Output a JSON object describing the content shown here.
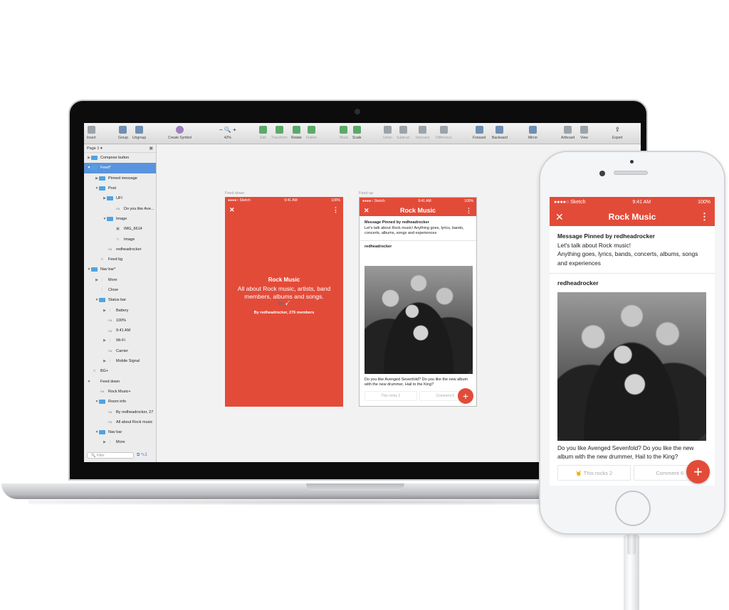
{
  "toolbar": {
    "items": [
      {
        "label": "Insert",
        "icon": "insert-icon"
      },
      {
        "label": "Group",
        "icon": "group-icon"
      },
      {
        "label": "Ungroup",
        "icon": "ungroup-icon"
      },
      {
        "label": "Create Symbol",
        "icon": "symbol-icon"
      },
      {
        "label": "42%",
        "icon": "zoom-icon"
      },
      {
        "label": "Edit",
        "icon": "edit-icon"
      },
      {
        "label": "Transform",
        "icon": "transform-icon"
      },
      {
        "label": "Rotate",
        "icon": "rotate-icon"
      },
      {
        "label": "Flatten",
        "icon": "flatten-icon"
      },
      {
        "label": "Mask",
        "icon": "mask-icon"
      },
      {
        "label": "Scale",
        "icon": "scale-icon"
      },
      {
        "label": "Union",
        "icon": "union-icon"
      },
      {
        "label": "Subtract",
        "icon": "subtract-icon"
      },
      {
        "label": "Intersect",
        "icon": "intersect-icon"
      },
      {
        "label": "Difference",
        "icon": "difference-icon"
      },
      {
        "label": "Forward",
        "icon": "forward-icon"
      },
      {
        "label": "Backward",
        "icon": "backward-icon"
      },
      {
        "label": "Mirror",
        "icon": "mirror-icon"
      },
      {
        "label": "Artboard",
        "icon": "artboard-icon"
      },
      {
        "label": "View",
        "icon": "view-icon"
      },
      {
        "label": "Export",
        "icon": "export-icon"
      }
    ]
  },
  "sidebar": {
    "page": "Page 1",
    "layers": [
      {
        "label": "Compose button",
        "type": "folder"
      },
      {
        "label": "Feed*",
        "type": "folder",
        "selected": true
      },
      {
        "label": "Pinned message",
        "type": "folder"
      },
      {
        "label": "Post",
        "type": "folder"
      },
      {
        "label": "UFI",
        "type": "folder"
      },
      {
        "label": "Do you like Ave...",
        "type": "text"
      },
      {
        "label": "Image",
        "type": "folder"
      },
      {
        "label": "IMG_6614",
        "type": "image"
      },
      {
        "label": "Image",
        "type": "shape"
      },
      {
        "label": "redheadrocker",
        "type": "text"
      },
      {
        "label": "Feed bg",
        "type": "shape"
      },
      {
        "label": "Nav bar*",
        "type": "folder"
      },
      {
        "label": "More",
        "type": "symbol"
      },
      {
        "label": "Close",
        "type": "symbol"
      },
      {
        "label": "Status bar",
        "type": "folder"
      },
      {
        "label": "Battery",
        "type": "symbol"
      },
      {
        "label": "100%",
        "type": "text"
      },
      {
        "label": "9:41 AM",
        "type": "text"
      },
      {
        "label": "Wi-Fi",
        "type": "symbol"
      },
      {
        "label": "Carrier",
        "type": "text"
      },
      {
        "label": "Mobile Signal",
        "type": "symbol"
      },
      {
        "label": "BG+",
        "type": "shape"
      },
      {
        "label": "Feed down",
        "type": "artboard"
      },
      {
        "label": "Rock Music+",
        "type": "text"
      },
      {
        "label": "Room info",
        "type": "folder"
      },
      {
        "label": "By redheadrocker, 27",
        "type": "text"
      },
      {
        "label": "All about Rock music",
        "type": "text"
      },
      {
        "label": "Nav bar",
        "type": "folder"
      },
      {
        "label": "More",
        "type": "symbol"
      }
    ],
    "filter_placeholder": "Filter"
  },
  "canvas": {
    "feed_down_label": "Feed down",
    "feed_up_label": "Feed up",
    "feed_down": {
      "carrier": "●●●●○ Sketch",
      "time": "9:41 AM",
      "battery": "100%",
      "title": "Rock Music",
      "description": "All about Rock music, artists, band members, albums and songs.",
      "emoji": "🎶🎸",
      "byline": "By redheadrocker, 276 members"
    },
    "feed_up": {
      "carrier": "●●●●○ Sketch",
      "time": "9:41 AM",
      "battery": "100%",
      "title": "Rock Music",
      "pinned_head": "Message Pinned by redheadrocker",
      "pinned_body": "Let's talk about Rock music! Anything goes, lyrics, bands, concerts, albums, songs and experiences",
      "author": "redheadrocker",
      "caption": "Do you like Avenged Sevenfold? Do you like the new album with the new drummer, Hail to the King?",
      "rocks": "This rocks   2",
      "comment": "Comment   6"
    }
  },
  "phone": {
    "carrier": "●●●●○ Sketch",
    "time": "9:41 AM",
    "battery": "100%",
    "title": "Rock Music",
    "pinned_head": "Message Pinned by redheadrocker",
    "pinned_line1": "Let's talk about Rock music!",
    "pinned_line2": "Anything goes, lyrics, bands, concerts, albums, songs and experiences",
    "author": "redheadrocker",
    "caption": "Do you like Avenged Sevenfold? Do you like the new album with the new drummer, Hail to the King?",
    "rocks": "🤘 This rocks   2",
    "comment": "Comment   6",
    "fab": "+"
  },
  "colors": {
    "brand_red": "#e34b39",
    "selection_blue": "#5a94de"
  }
}
